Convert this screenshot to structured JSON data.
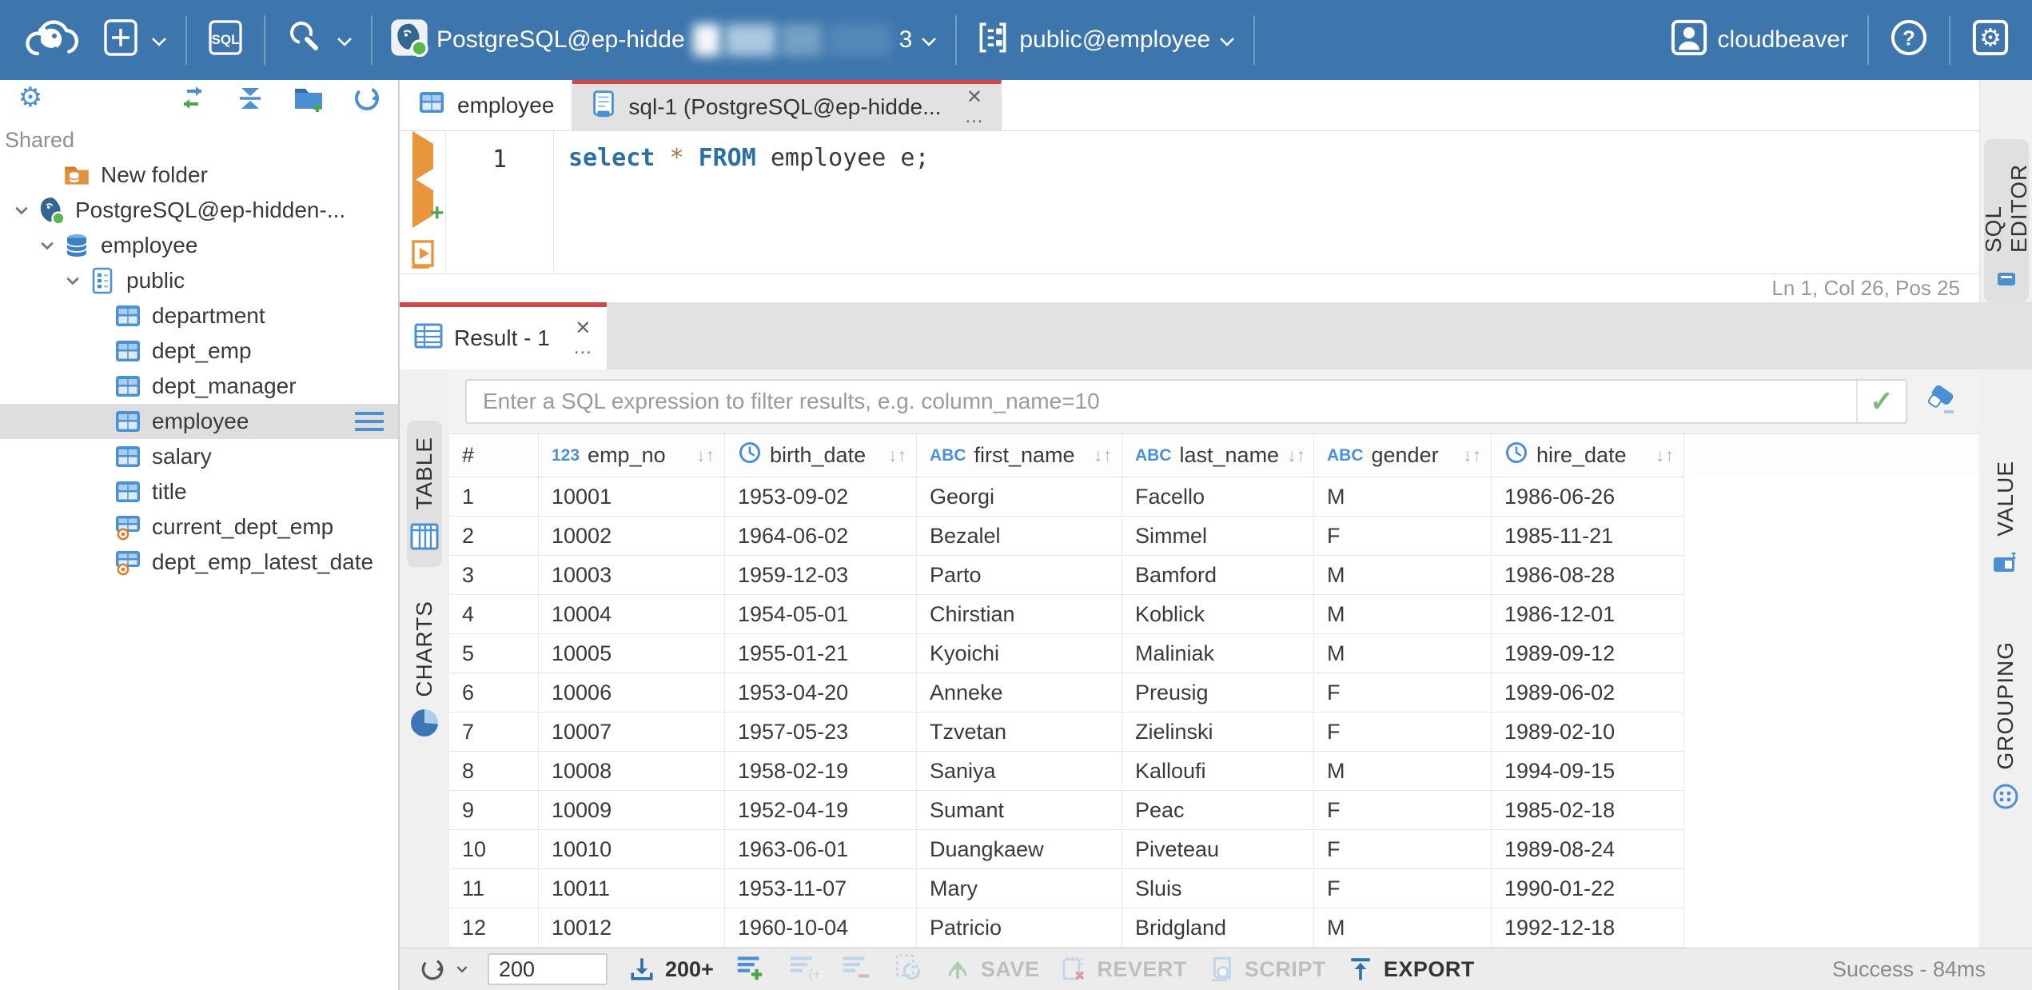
{
  "colors": {
    "topbar_blue": "#3d76ad",
    "accent_red": "#cf4747",
    "icon_blue": "#4a90d2",
    "green": "#4ca64c",
    "orange": "#e8953c"
  },
  "ui": {
    "close": "✕",
    "more": "..."
  },
  "topbar": {
    "connection_label": "PostgreSQL@ep-hidde",
    "connection_suffix": "3",
    "schema_label": "public@employee",
    "user_label": "cloudbeaver",
    "sql_badge": "SQL",
    "help_glyph": "?"
  },
  "sidebar": {
    "section_label": "Shared",
    "tree": [
      {
        "label": "New folder",
        "icon": "folder",
        "level": 1,
        "chevron": false,
        "selected": false,
        "menu": false
      },
      {
        "label": "PostgreSQL@ep-hidden-...",
        "icon": "postgres",
        "level": 0,
        "chevron": true,
        "selected": false,
        "menu": false
      },
      {
        "label": "employee",
        "icon": "database",
        "level": 1,
        "chevron": true,
        "selected": false,
        "menu": false
      },
      {
        "label": "public",
        "icon": "schema",
        "level": 2,
        "chevron": true,
        "selected": false,
        "menu": false
      },
      {
        "label": "department",
        "icon": "table",
        "level": 3,
        "chevron": false,
        "selected": false,
        "menu": false
      },
      {
        "label": "dept_emp",
        "icon": "table",
        "level": 3,
        "chevron": false,
        "selected": false,
        "menu": false
      },
      {
        "label": "dept_manager",
        "icon": "table",
        "level": 3,
        "chevron": false,
        "selected": false,
        "menu": false
      },
      {
        "label": "employee",
        "icon": "table",
        "level": 3,
        "chevron": false,
        "selected": true,
        "menu": true
      },
      {
        "label": "salary",
        "icon": "table",
        "level": 3,
        "chevron": false,
        "selected": false,
        "menu": false
      },
      {
        "label": "title",
        "icon": "table",
        "level": 3,
        "chevron": false,
        "selected": false,
        "menu": false
      },
      {
        "label": "current_dept_emp",
        "icon": "view",
        "level": 3,
        "chevron": false,
        "selected": false,
        "menu": false
      },
      {
        "label": "dept_emp_latest_date",
        "icon": "view",
        "level": 3,
        "chevron": false,
        "selected": false,
        "menu": false
      }
    ]
  },
  "editor": {
    "tab_employee": "employee",
    "tab_sql": "sql-1 (PostgreSQL@ep-hidde...",
    "line_number": "1",
    "code_tokens": [
      {
        "text": "select",
        "cls": "kw"
      },
      {
        "text": " ",
        "cls": "plain"
      },
      {
        "text": "*",
        "cls": "star"
      },
      {
        "text": " ",
        "cls": "plain"
      },
      {
        "text": "FROM",
        "cls": "kw"
      },
      {
        "text": " employee e;",
        "cls": "plain"
      }
    ],
    "status": "Ln 1, Col 26, Pos 25",
    "rail_label": "SQL EDITOR"
  },
  "results": {
    "tab_label": "Result - 1",
    "filter_placeholder": "Enter a SQL expression to filter results, e.g. column_name=10",
    "left_tabs": {
      "table": "TABLE",
      "charts": "CHARTS"
    },
    "right_tabs": {
      "value": "VALUE",
      "grouping": "GROUPING"
    },
    "grid": {
      "type_labels": {
        "number": "123",
        "string": "ABC"
      },
      "sort_glyph": "↓↑",
      "columns": [
        {
          "label": "#",
          "type": "none",
          "sortable": false
        },
        {
          "label": "emp_no",
          "type": "number",
          "sortable": true
        },
        {
          "label": "birth_date",
          "type": "datetime",
          "sortable": true
        },
        {
          "label": "first_name",
          "type": "string",
          "sortable": true
        },
        {
          "label": "last_name",
          "type": "string",
          "sortable": true
        },
        {
          "label": "gender",
          "type": "string",
          "sortable": true
        },
        {
          "label": "hire_date",
          "type": "datetime",
          "sortable": true
        }
      ],
      "rows": [
        [
          "1",
          "10001",
          "1953-09-02",
          "Georgi",
          "Facello",
          "M",
          "1986-06-26"
        ],
        [
          "2",
          "10002",
          "1964-06-02",
          "Bezalel",
          "Simmel",
          "F",
          "1985-11-21"
        ],
        [
          "3",
          "10003",
          "1959-12-03",
          "Parto",
          "Bamford",
          "M",
          "1986-08-28"
        ],
        [
          "4",
          "10004",
          "1954-05-01",
          "Chirstian",
          "Koblick",
          "M",
          "1986-12-01"
        ],
        [
          "5",
          "10005",
          "1955-01-21",
          "Kyoichi",
          "Maliniak",
          "M",
          "1989-09-12"
        ],
        [
          "6",
          "10006",
          "1953-04-20",
          "Anneke",
          "Preusig",
          "F",
          "1989-06-02"
        ],
        [
          "7",
          "10007",
          "1957-05-23",
          "Tzvetan",
          "Zielinski",
          "F",
          "1989-02-10"
        ],
        [
          "8",
          "10008",
          "1958-02-19",
          "Saniya",
          "Kalloufi",
          "M",
          "1994-09-15"
        ],
        [
          "9",
          "10009",
          "1952-04-19",
          "Sumant",
          "Peac",
          "F",
          "1985-02-18"
        ],
        [
          "10",
          "10010",
          "1963-06-01",
          "Duangkaew",
          "Piveteau",
          "F",
          "1989-08-24"
        ],
        [
          "11",
          "10011",
          "1953-11-07",
          "Mary",
          "Sluis",
          "F",
          "1990-01-22"
        ],
        [
          "12",
          "10012",
          "1960-10-04",
          "Patricio",
          "Bridgland",
          "M",
          "1992-12-18"
        ]
      ]
    },
    "toolbar": {
      "row_count_value": "200",
      "fetch_label": "200+",
      "save_label": "SAVE",
      "revert_label": "REVERT",
      "script_label": "SCRIPT",
      "export_label": "EXPORT",
      "status": "Success - 84ms"
    }
  }
}
